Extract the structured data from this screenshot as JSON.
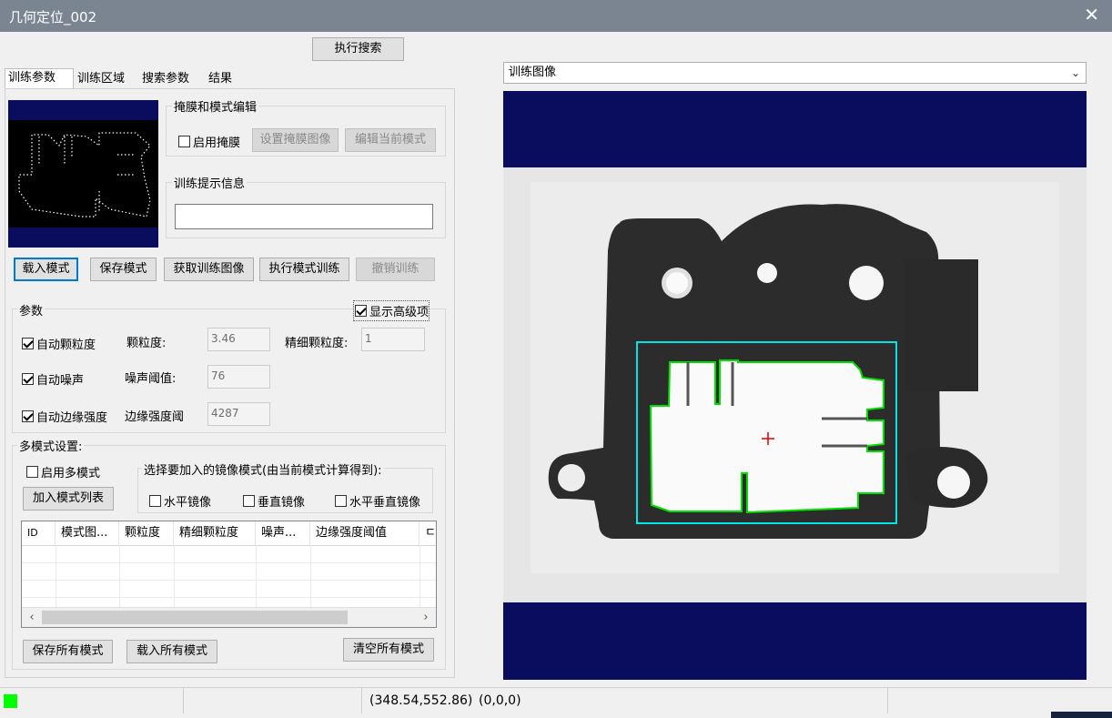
{
  "window": {
    "title": "几何定位_002",
    "close_label": "✕"
  },
  "search_button": "执行搜索",
  "tabs": [
    {
      "label": "训练参数",
      "active": true
    },
    {
      "label": "训练区域",
      "active": false
    },
    {
      "label": "搜索参数",
      "active": false
    },
    {
      "label": "结果",
      "active": false
    }
  ],
  "mask_group": {
    "title": "掩膜和模式编辑",
    "enable_mask_label": "启用掩膜",
    "enable_mask_checked": false,
    "set_mask_label": "设置掩膜图像",
    "edit_pattern_label": "编辑当前模式"
  },
  "train_info": {
    "title": "训练提示信息",
    "value": ""
  },
  "train_buttons": {
    "load": "载入模式",
    "save": "保存模式",
    "get_image": "获取训练图像",
    "train": "执行模式训练",
    "undo": "撤销训练"
  },
  "params": {
    "title": "参数",
    "show_advanced_label": "显示高级项",
    "show_advanced_checked": true,
    "auto_grain_label": "自动颗粒度",
    "auto_grain_checked": true,
    "grain_label": "颗粒度:",
    "grain_value": "3.46",
    "fine_grain_label": "精细颗粒度:",
    "fine_grain_value": "1",
    "auto_noise_label": "自动噪声",
    "auto_noise_checked": true,
    "noise_label": "噪声阈值:",
    "noise_value": "76",
    "auto_edge_label": "自动边缘强度",
    "auto_edge_checked": true,
    "edge_label": "边缘强度阈",
    "edge_value": "4287"
  },
  "multi": {
    "title": "多模式设置:",
    "enable_label": "启用多模式",
    "enable_checked": false,
    "add_list_label": "加入模式列表",
    "mirror_title": "选择要加入的镜像模式(由当前模式计算得到):",
    "horizontal_label": "水平镜像",
    "vertical_label": "垂直镜像",
    "both_label": "水平垂直镜像",
    "columns": [
      "ID",
      "模式图...",
      "颗粒度",
      "精细颗粒度",
      "噪声...",
      "边缘强度阈值",
      "ㄷ"
    ],
    "save_all": "保存所有模式",
    "load_all": "载入所有模式",
    "clear_all": "清空所有模式"
  },
  "image_select": {
    "value": "训练图像"
  },
  "status": {
    "coords": "(348.54,552.86)",
    "pixel": "(0,0,0)",
    "indicator_color": "#00ff00"
  }
}
